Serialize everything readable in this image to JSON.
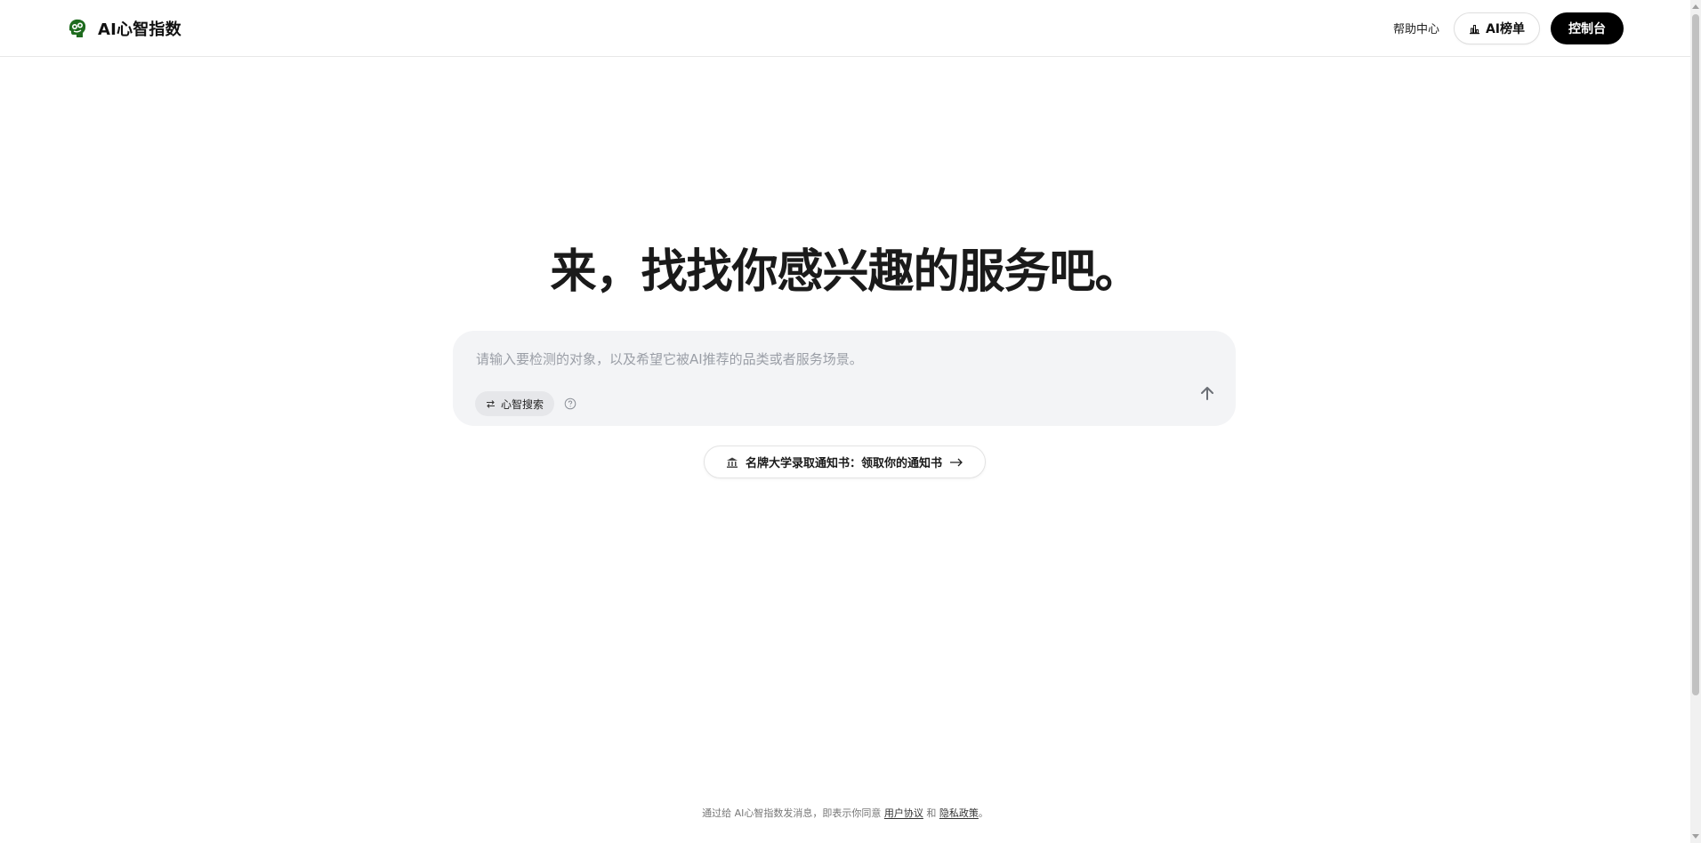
{
  "header": {
    "brand_name": "AI心智指数",
    "help_label": "帮助中心",
    "rank_label": "AI榜单",
    "console_label": "控制台"
  },
  "main": {
    "title": "来，找找你感兴趣的服务吧。",
    "search": {
      "placeholder": "请输入要检测的对象，以及希望它被AI推荐的品类或者服务场景。",
      "value": ""
    },
    "mode_chip_label": "心智搜索",
    "promo_label": "名牌大学录取通知书：领取你的通知书"
  },
  "footer": {
    "prefix": "通过给 AI心智指数发消息，即表示你同意",
    "user_agreement": "用户协议",
    "and": "和",
    "privacy_policy": "隐私政策",
    "suffix": "。"
  },
  "icons": {
    "brand_logo": "green-brain-logo-icon",
    "rank": "bar-chart-icon",
    "mode": "swap-arrows-icon",
    "help": "question-circle-icon",
    "send": "arrow-up-icon",
    "promo": "bank-building-icon",
    "promo_arrow": "arrow-right-icon"
  },
  "colors": {
    "brand_green": "#1e6b1e",
    "console_bg": "#000000",
    "search_bg": "#f3f4f6"
  }
}
